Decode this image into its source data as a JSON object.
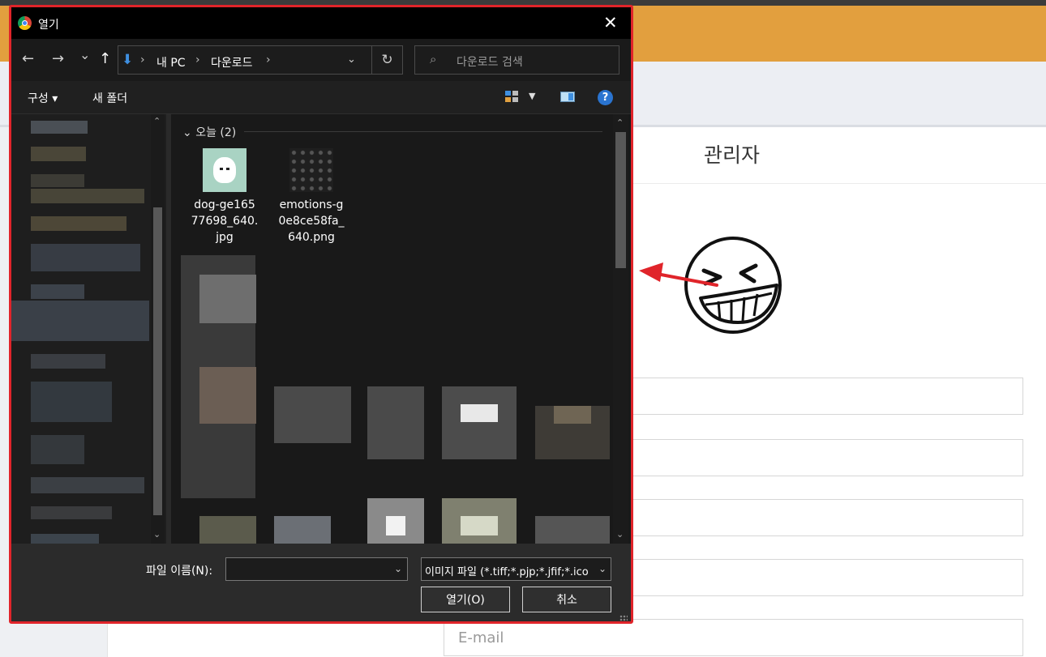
{
  "page": {
    "admin_title": "관리자",
    "email_placeholder": "E-mail"
  },
  "dialog": {
    "title": "열기",
    "nav": {
      "back": "←",
      "forward": "→",
      "recent": "⌄",
      "up": "↑"
    },
    "address": {
      "root": "내 PC",
      "folder": "다운로드"
    },
    "search_placeholder": "다운로드 검색",
    "toolbar": {
      "organize": "구성 ▾",
      "new_folder": "새 폴더"
    },
    "group_header": "오늘 (2)",
    "files": [
      {
        "name": "dog-ge16577698_640.jpg"
      },
      {
        "name": "emotions-g0e8ce58fa_640.png"
      }
    ],
    "file_name_label": "파일 이름(N):",
    "file_name_value": "",
    "file_type": "이미지 파일 (*.tiff;*.pjp;*.jfif;*.ico",
    "open_button": "열기(O)",
    "cancel_button": "취소"
  },
  "colors": {
    "accent_orange": "#e29f3e",
    "highlight_red": "#e0242a"
  }
}
